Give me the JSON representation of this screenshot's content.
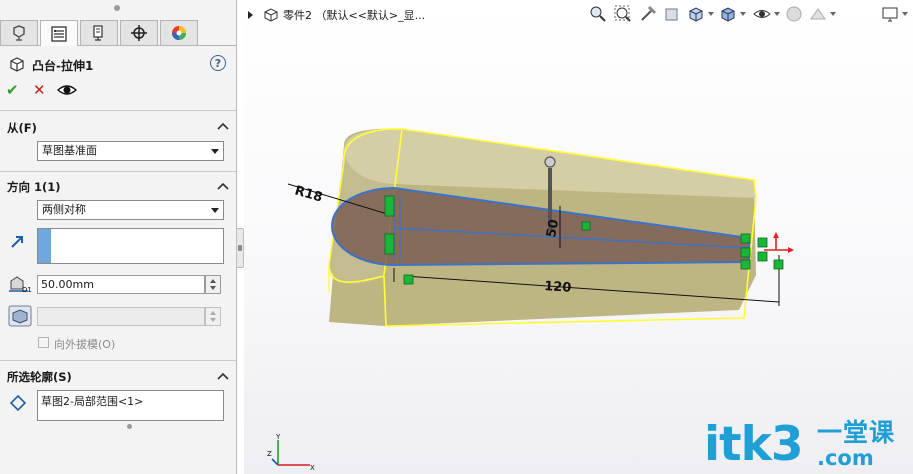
{
  "panel": {
    "tabs": [
      {
        "icon": "feature-manager-icon"
      },
      {
        "icon": "property-manager-icon",
        "active": true
      },
      {
        "icon": "configuration-manager-icon"
      },
      {
        "icon": "dimxpert-icon"
      },
      {
        "icon": "display-manager-icon"
      }
    ],
    "feature_title": "凸台-拉伸1",
    "help": "?",
    "ok": "✔",
    "cancel": "✕",
    "from": {
      "title": "从(F)",
      "value": "草图基准面"
    },
    "direction1": {
      "title": "方向 1(1)",
      "end_condition": "两侧对称",
      "depth": "50.00mm",
      "draft_outward": "向外拔模(O)"
    },
    "selected_contours": {
      "title": "所选轮廓(S)",
      "items": [
        "草图2-局部范围<1>"
      ]
    }
  },
  "viewport": {
    "part_name": "零件2 （默认<<默认>_显...",
    "dimensions": {
      "radius": "R18",
      "height": "50",
      "length": "120"
    },
    "hud_icons": [
      "zoom-to-fit-icon",
      "zoom-to-area-icon",
      "previous-view-icon",
      "section-view-icon",
      "view-orientation-icon",
      "display-style-icon",
      "hide-show-items-icon",
      "edit-appearance-icon",
      "apply-scene-icon",
      "view-settings-icon"
    ],
    "triad": {
      "x": "X",
      "y": "Y",
      "z": "Z"
    },
    "watermark": {
      "main": "itk3",
      "sub1": "一堂课",
      "sub2": ".com"
    }
  },
  "colors": {
    "body_face": "#bdb683",
    "edge_highlight": "#ffff33",
    "sketch_blue": "#3a73c9",
    "handle_green": "#19b63a",
    "watermark": "#1f9fd6"
  }
}
